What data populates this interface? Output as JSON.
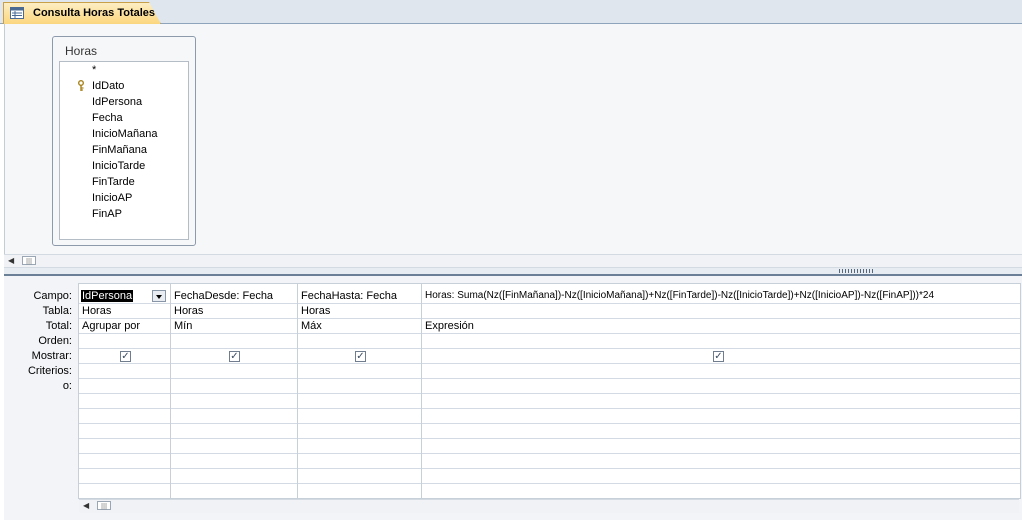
{
  "tab": {
    "label": "Consulta Horas Totales",
    "icon": "query-icon"
  },
  "table": {
    "title": "Horas",
    "fields": [
      "*",
      "IdDato",
      "IdPersona",
      "Fecha",
      "InicioMañana",
      "FinMañana",
      "InicioTarde",
      "FinTarde",
      "InicioAP",
      "FinAP"
    ],
    "primary_key_icon": "key-icon"
  },
  "grid": {
    "row_labels": {
      "campo": "Campo:",
      "tabla": "Tabla:",
      "total": "Total:",
      "orden": "Orden:",
      "mostrar": "Mostrar:",
      "criterios": "Criterios:",
      "o": "o:"
    },
    "columns": [
      {
        "campo": "IdPersona",
        "tabla": "Horas",
        "total": "Agrupar por",
        "mostrar": true
      },
      {
        "campo": "FechaDesde: Fecha",
        "tabla": "Horas",
        "total": "Mín",
        "mostrar": true
      },
      {
        "campo": "FechaHasta: Fecha",
        "tabla": "Horas",
        "total": "Máx",
        "mostrar": true
      },
      {
        "campo": "Horas: Suma(Nz([FinMañana])-Nz([InicioMañana])+Nz([FinTarde])-Nz([InicioTarde])+Nz([InicioAP])-Nz([FinAP]))*24",
        "tabla": "",
        "total": "Expresión",
        "mostrar": true
      }
    ],
    "check_glyph": "✓"
  },
  "scrollbar": {
    "left_arrow": "◀",
    "thumb_glyph": "|||"
  },
  "colors": {
    "tab_bg": "#fbd67e",
    "selection": "#000000",
    "splitter": "#6b7f96"
  }
}
